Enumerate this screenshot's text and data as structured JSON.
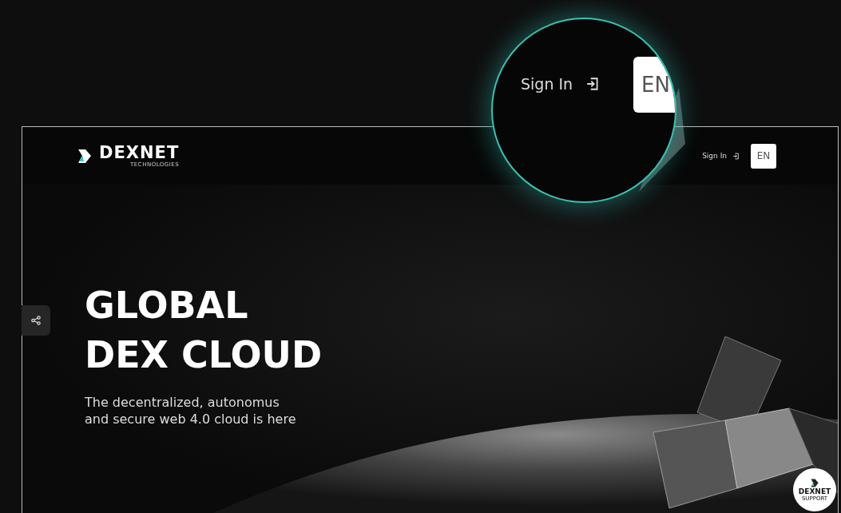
{
  "header": {
    "logo": {
      "name": "DEXNET",
      "tagline": "TECHNOLOGIES"
    },
    "sign_in": "Sign In",
    "language": "EN"
  },
  "magnifier": {
    "sign_in": "Sign In",
    "language": "EN"
  },
  "hero": {
    "title_lines": [
      "GLOBAL",
      "DEX CLOUD"
    ],
    "subtitle_lines": [
      "The decentralized, autonomus",
      "and secure web 4.0 cloud is here"
    ]
  },
  "support_badge": {
    "name": "DEXNET",
    "label": "SUPPORT"
  }
}
